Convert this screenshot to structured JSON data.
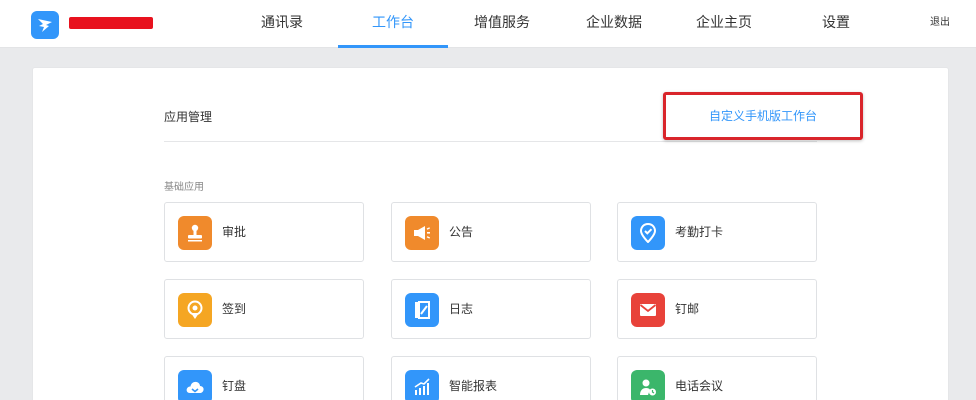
{
  "colors": {
    "accent": "#3296fa",
    "highlight_border": "#d9252b",
    "redacted": "#e8121e"
  },
  "header": {
    "org_name": "redacted",
    "nav": [
      {
        "label": "通讯录",
        "active": false
      },
      {
        "label": "工作台",
        "active": true
      },
      {
        "label": "增值服务",
        "active": false
      },
      {
        "label": "企业数据",
        "active": false
      },
      {
        "label": "企业主页",
        "active": false
      },
      {
        "label": "设置",
        "active": false
      }
    ],
    "logout_label": "退出"
  },
  "main": {
    "section_title": "应用管理",
    "customize_button": "自定义手机版工作台",
    "group_label": "基础应用",
    "apps": [
      {
        "name": "审批",
        "icon": "stamp-icon",
        "color": "#f08a2c"
      },
      {
        "name": "公告",
        "icon": "megaphone-icon",
        "color": "#f08a2c"
      },
      {
        "name": "考勤打卡",
        "icon": "location-check-icon",
        "color": "#3296fa"
      },
      {
        "name": "签到",
        "icon": "location-pin-icon",
        "color": "#f5a623"
      },
      {
        "name": "日志",
        "icon": "notebook-icon",
        "color": "#3296fa"
      },
      {
        "name": "钉邮",
        "icon": "mail-icon",
        "color": "#e8423a"
      },
      {
        "name": "钉盘",
        "icon": "cloud-icon",
        "color": "#3296fa"
      },
      {
        "name": "智能报表",
        "icon": "chart-icon",
        "color": "#3296fa"
      },
      {
        "name": "电话会议",
        "icon": "conference-call-icon",
        "color": "#3bb66b"
      }
    ]
  }
}
